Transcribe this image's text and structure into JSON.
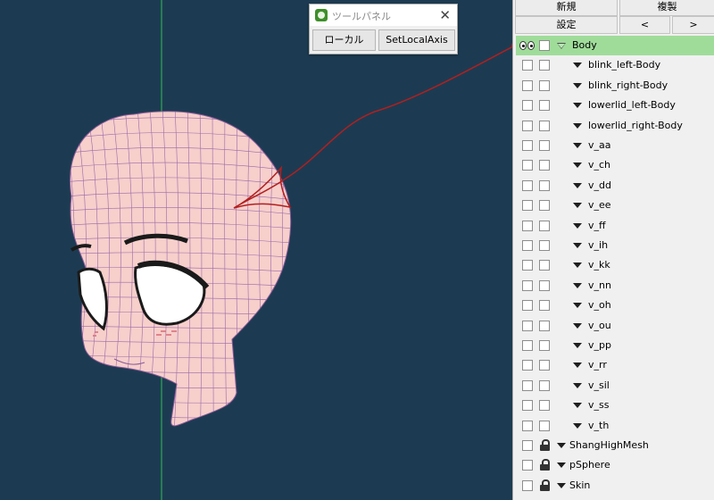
{
  "tool_panel": {
    "title": "ツールパネル",
    "close": "✕",
    "buttons": {
      "local": "ローカル",
      "set_local_axis": "SetLocalAxis"
    }
  },
  "right_panel": {
    "buttons": {
      "new": "新規",
      "duplicate": "複製",
      "settings": "設定",
      "prev": "<",
      "next": ">"
    },
    "tree": {
      "body": {
        "label": "Body",
        "selected": true
      },
      "blendshapes": [
        "blink_left-Body",
        "blink_right-Body",
        "lowerlid_left-Body",
        "lowerlid_right-Body",
        "v_aa",
        "v_ch",
        "v_dd",
        "v_ee",
        "v_ff",
        "v_ih",
        "v_kk",
        "v_nn",
        "v_oh",
        "v_ou",
        "v_pp",
        "v_rr",
        "v_sil",
        "v_ss",
        "v_th"
      ],
      "locked_items": [
        "ShangHighMesh",
        "pSphere",
        "Skin"
      ]
    }
  },
  "colors": {
    "viewport_bg": "#1c3b52",
    "selection": "#9fdc9a",
    "annotation": "#b21f1f",
    "mesh_fill": "#f6c9c6",
    "mesh_wire": "#8a5a9a"
  }
}
